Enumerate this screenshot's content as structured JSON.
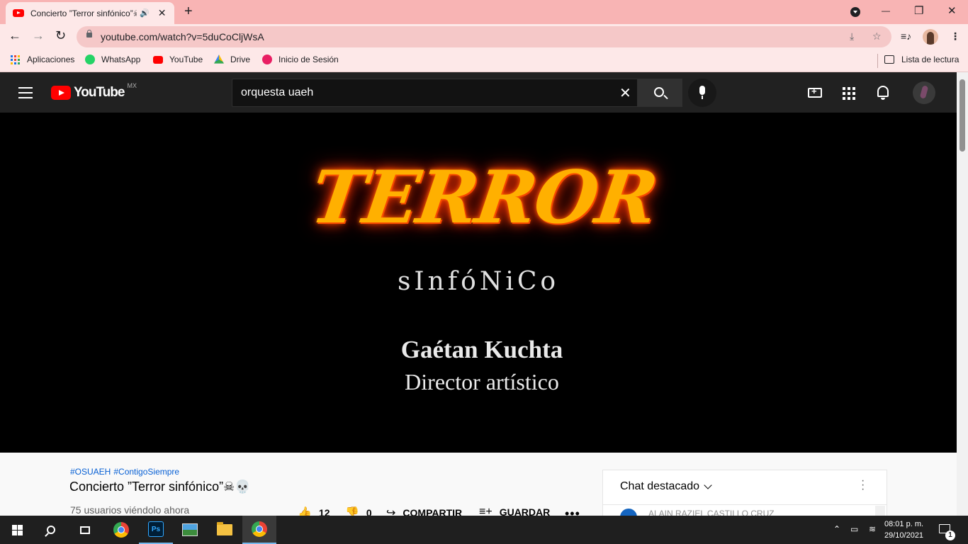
{
  "browser": {
    "tab": {
      "title": "Concierto ”Terror sinfónico”☠",
      "audio_icon": "speaker-icon",
      "close": "✕"
    },
    "new_tab": "+",
    "window_controls": {
      "minimize": "—",
      "maximize": "❐",
      "close": "✕"
    },
    "url": "youtube.com/watch?v=5duCoCljWsA",
    "bookmarks": [
      {
        "label": "Aplicaciones",
        "icon": "apps-grid-icon"
      },
      {
        "label": "WhatsApp",
        "icon": "whatsapp-icon",
        "color": "#25d366"
      },
      {
        "label": "YouTube",
        "icon": "youtube-icon",
        "color": "#ff0000"
      },
      {
        "label": "Drive",
        "icon": "drive-icon",
        "color": "#fbbc04"
      },
      {
        "label": "Inicio de Sesión",
        "icon": "login-icon",
        "color": "#e91e63"
      }
    ],
    "reading_list": "Lista de lectura"
  },
  "youtube": {
    "logo_text": "YouTube",
    "country_code": "MX",
    "search_query": "orquesta uaeh",
    "accent": "#ff0000"
  },
  "video": {
    "title_art": "TERROR",
    "subtitle_art": "sInfóNiCo",
    "director_name": "Gaétan Kuchta",
    "director_role": "Director artístico"
  },
  "details": {
    "hashtags": [
      "#OSUAEH",
      "#ContigoSiempre"
    ],
    "title": "Concierto ”Terror sinfónico”☠💀",
    "viewers": "75 usuarios viéndolo ahora",
    "likes": "12",
    "dislikes": "0",
    "share_label": "COMPARTIR",
    "save_label": "GUARDAR"
  },
  "chat": {
    "header": "Chat destacado",
    "first_author": "ALAIN RAZIEL CASTILLO CRUZ"
  },
  "taskbar": {
    "time": "08:01 p. m.",
    "date": "29/10/2021",
    "notification_count": "1",
    "ps_label": "Ps"
  }
}
